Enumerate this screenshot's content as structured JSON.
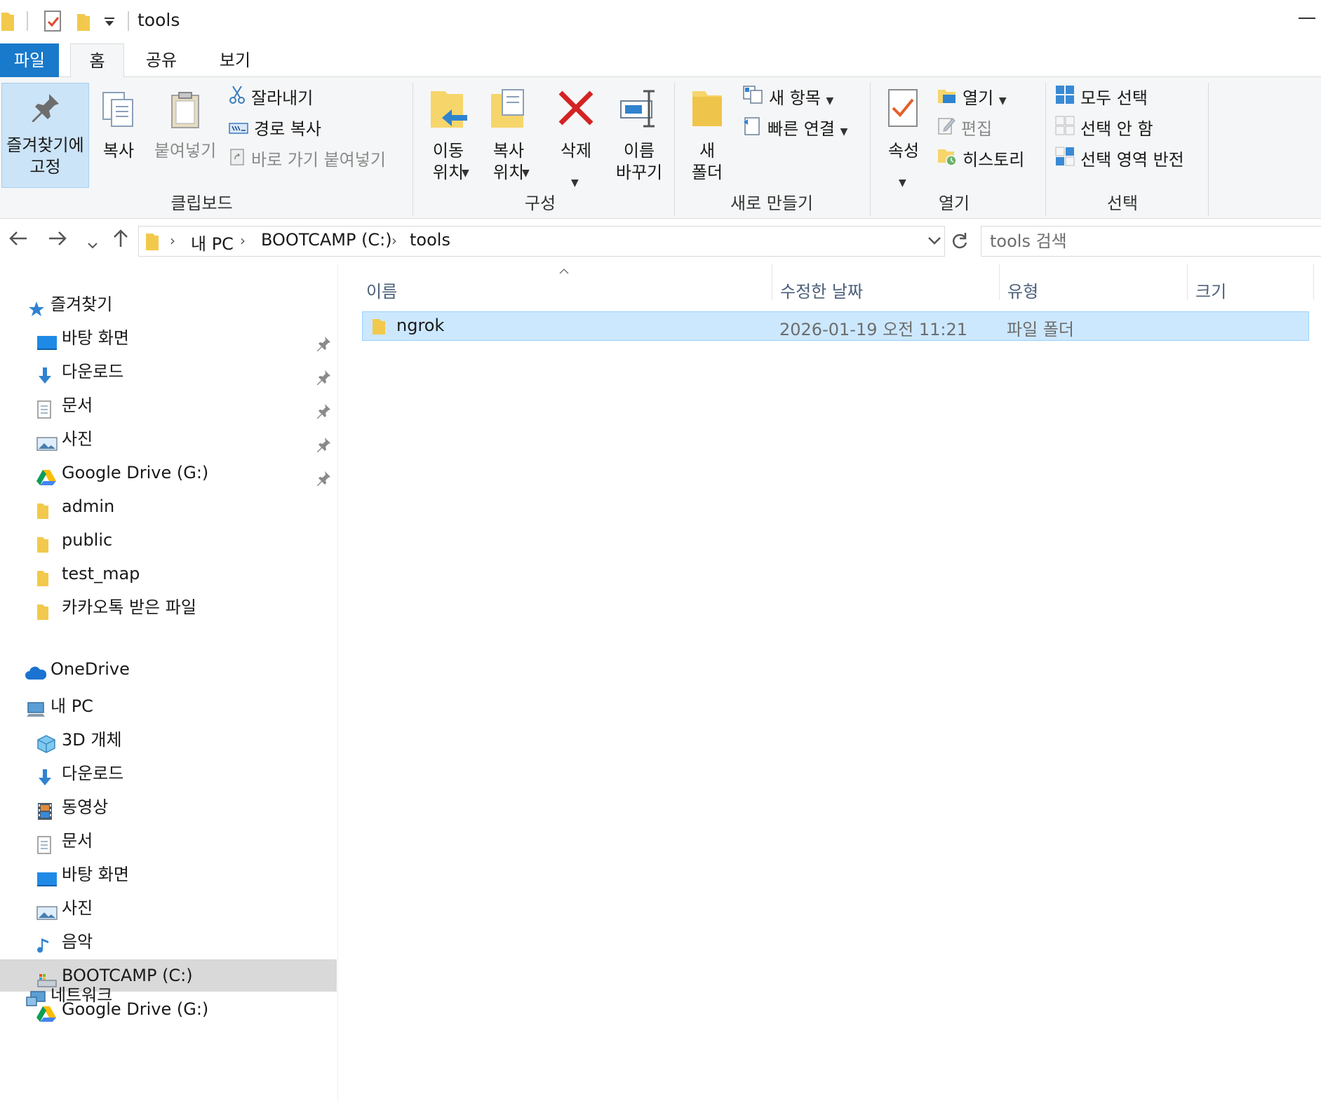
{
  "window": {
    "title": "tools"
  },
  "ribbon_tabs": {
    "file": "파일",
    "home": "홈",
    "share": "공유",
    "view": "보기"
  },
  "ribbon": {
    "clipboard": {
      "label": "클립보드",
      "pin_quick": "즐겨찾기에\n고정",
      "copy": "복사",
      "paste": "붙여넣기",
      "cut": "잘라내기",
      "copy_path": "경로 복사",
      "paste_shortcut": "바로 가기 붙여넣기"
    },
    "organize": {
      "label": "구성",
      "move_to": "이동\n위치",
      "copy_to": "복사\n위치",
      "delete": "삭제",
      "rename": "이름\n바꾸기"
    },
    "new": {
      "label": "새로 만들기",
      "new_folder": "새\n폴더",
      "new_item": "새 항목",
      "easy_access": "빠른 연결"
    },
    "open": {
      "label": "열기",
      "properties": "속성",
      "open": "열기",
      "edit": "편집",
      "history": "히스토리"
    },
    "select": {
      "label": "선택",
      "select_all": "모두 선택",
      "select_none": "선택 안 함",
      "invert": "선택 영역 반전"
    }
  },
  "address": {
    "crumbs": [
      "내 PC",
      "BOOTCAMP (C:)",
      "tools"
    ],
    "search_placeholder": "tools 검색"
  },
  "nav": {
    "quick_access": "즐겨찾기",
    "quick_items": [
      {
        "label": "바탕 화면",
        "icon": "desktop-icon"
      },
      {
        "label": "다운로드",
        "icon": "download-icon"
      },
      {
        "label": "문서",
        "icon": "document-icon"
      },
      {
        "label": "사진",
        "icon": "pictures-icon"
      },
      {
        "label": "Google Drive (G:)",
        "icon": "google-drive-icon"
      },
      {
        "label": "admin",
        "icon": "folder-icon"
      },
      {
        "label": "public",
        "icon": "folder-icon"
      },
      {
        "label": "test_map",
        "icon": "folder-icon"
      },
      {
        "label": "카카오톡 받은 파일",
        "icon": "folder-icon"
      }
    ],
    "onedrive": "OneDrive",
    "this_pc": "내 PC",
    "pc_items": [
      {
        "label": "3D 개체",
        "icon": "3d-objects-icon"
      },
      {
        "label": "다운로드",
        "icon": "download-icon"
      },
      {
        "label": "동영상",
        "icon": "video-icon"
      },
      {
        "label": "문서",
        "icon": "document-icon"
      },
      {
        "label": "바탕 화면",
        "icon": "desktop-icon"
      },
      {
        "label": "사진",
        "icon": "pictures-icon"
      },
      {
        "label": "음악",
        "icon": "music-icon"
      },
      {
        "label": "BOOTCAMP (C:)",
        "icon": "drive-icon"
      },
      {
        "label": "Google Drive (G:)",
        "icon": "google-drive-icon"
      }
    ],
    "network": "네트워크"
  },
  "files": {
    "columns": {
      "name": "이름",
      "modified": "수정한 날짜",
      "type": "유형",
      "size": "크기"
    },
    "rows": [
      {
        "name": "ngrok",
        "modified": "2026-01-19 오전 11:21",
        "type": "파일 폴더",
        "size": ""
      }
    ]
  },
  "colors": {
    "accent": "#1979ca",
    "selection": "#cce8ff",
    "ribbon_bg": "#f5f6f7"
  }
}
